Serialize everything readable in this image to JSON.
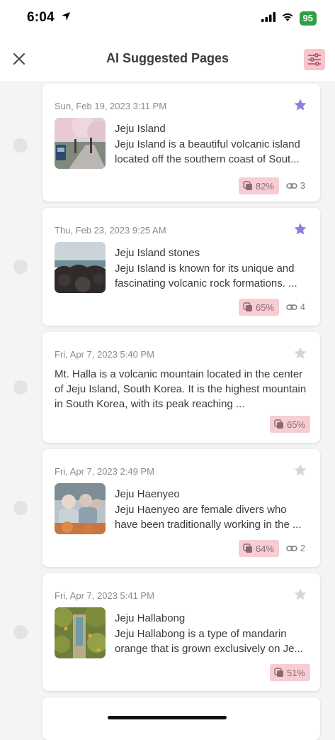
{
  "status": {
    "time": "6:04",
    "battery": "95"
  },
  "header": {
    "title": "AI Suggested Pages"
  },
  "cards": [
    {
      "date": "Sun, Feb 19, 2023 3:11 PM",
      "starred": true,
      "title": "Jeju Island",
      "text": "Jeju Island is a beautiful volcanic island located off the southern coast of Sout...",
      "score": "82%",
      "links": "3"
    },
    {
      "date": "Thu, Feb 23, 2023 9:25 AM",
      "starred": true,
      "title": "Jeju Island stones",
      "text": "Jeju Island is known for its unique and fascinating volcanic rock formations. ...",
      "score": "65%",
      "links": "4"
    },
    {
      "date": "Fri, Apr 7, 2023 5:40 PM",
      "starred": false,
      "text": "Mt. Halla is a volcanic mountain located in the center of Jeju Island, South Korea. It is the highest mountain in South Korea, with its peak reaching ...",
      "score": "65%"
    },
    {
      "date": "Fri, Apr 7, 2023 2:49 PM",
      "starred": false,
      "title": "Jeju Haenyeo",
      "text": "Jeju Haenyeo are female divers who have been traditionally working in the ...",
      "score": "64%",
      "links": "2"
    },
    {
      "date": "Fri, Apr 7, 2023 5:41 PM",
      "starred": false,
      "title": "Jeju Hallabong",
      "text": "Jeju Hallabong is a type of mandarin orange that is grown exclusively on Je...",
      "score": "51%"
    }
  ],
  "colors": {
    "star_active": "#8d7fd4",
    "star_inactive": "#d6d6d8",
    "badge_bg": "#f7cdd4",
    "filter_bg": "#f6c5cd"
  }
}
